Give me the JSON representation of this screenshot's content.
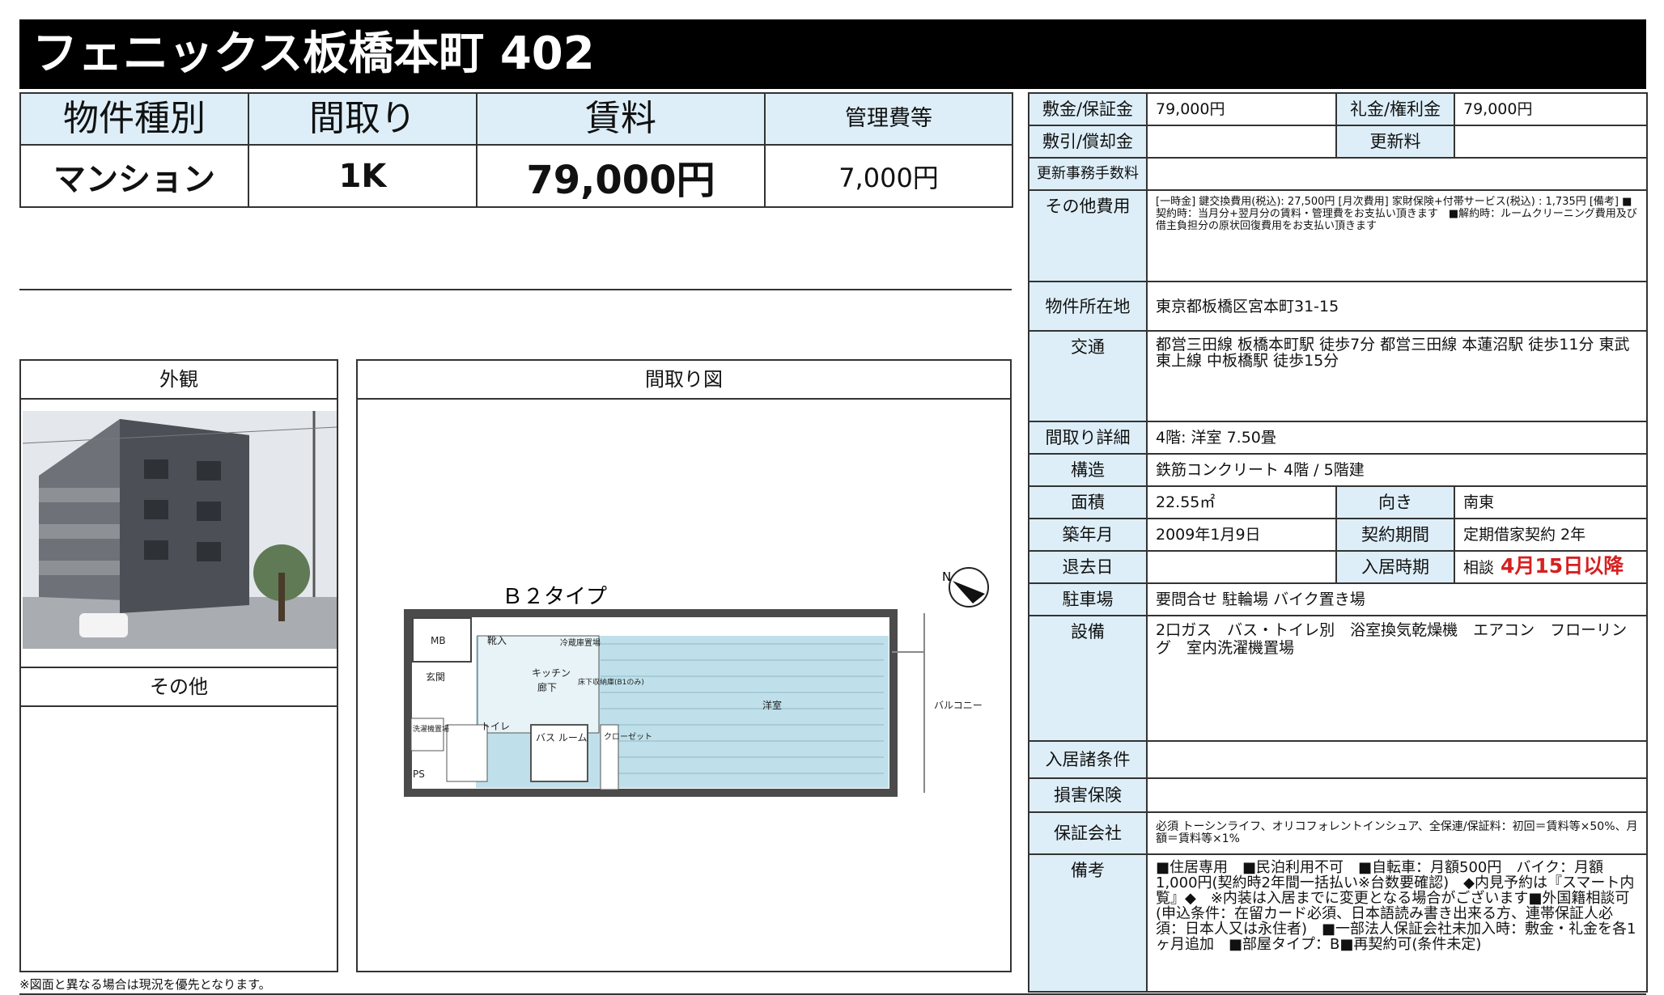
{
  "title": "フェニックス板橋本町 402",
  "summary": {
    "headers": [
      "物件種別",
      "間取り",
      "賃料",
      "管理費等"
    ],
    "values": [
      "マンション",
      "1K",
      "79,000円",
      "7,000円"
    ]
  },
  "panels": {
    "exterior": "外観",
    "other": "その他",
    "floorplan": "間取り図"
  },
  "floorplan": {
    "type_label": "Ｂ２タイプ",
    "compass": "N",
    "rooms": {
      "mb": "MB",
      "entrance_storage": "靴入",
      "fridge": "冷蔵庫置場",
      "kitchen": "キッチン",
      "hallway": "廊下",
      "underfloor": "床下収納庫(B1のみ)",
      "genkan": "玄関",
      "washer": "洗濯機置場",
      "toilet": "トイレ",
      "bath": "バス ルーム",
      "closet": "クローゼット",
      "western": "洋室",
      "balcony": "バルコニー",
      "ps": "PS"
    }
  },
  "note": "※図面と異なる場合は現況を優先となります。",
  "details": {
    "deposit_label": "敷金/保証金",
    "deposit": "79,000円",
    "key_money_label": "礼金/権利金",
    "key_money": "79,000円",
    "shikibiki_label": "敷引/償却金",
    "shikibiki": "",
    "renewal_label": "更新料",
    "renewal": "",
    "renewal_fee_label": "更新事務手数料",
    "renewal_fee": "",
    "other_costs_label": "その他費用",
    "other_costs": "[一時金] 鍵交換費用(税込): 27,500円\n[月次費用] 家財保険+付帯サービス(税込) : 1,735円\n[備考] ■契約時：当月分+翌月分の賃料・管理費をお支払い頂きます　■解約時：ルームクリーニング費用及び借主負担分の原状回復費用をお支払い頂きます",
    "address_label": "物件所在地",
    "address": "東京都板橋区宮本町31-15",
    "transport_label": "交通",
    "transport": "都営三田線 板橋本町駅 徒歩7分\n都営三田線 本蓮沼駅 徒歩11分\n東武東上線 中板橋駅 徒歩15分",
    "layout_detail_label": "間取り詳細",
    "layout_detail": "4階: 洋室 7.50畳",
    "structure_label": "構造",
    "structure": "鉄筋コンクリート 4階 / 5階建",
    "area_label": "面積",
    "area": "22.55㎡",
    "direction_label": "向き",
    "direction": "南東",
    "built_label": "築年月",
    "built": "2009年1月9日",
    "contract_label": "契約期間",
    "contract": "定期借家契約 2年",
    "vacate_label": "退去日",
    "vacate": "",
    "move_in_label": "入居時期",
    "move_in_prefix": "相談",
    "move_in_date": "4月15日以降",
    "parking_label": "駐車場",
    "parking": "要問合せ 駐輪場 バイク置き場",
    "equipment_label": "設備",
    "equipment": "2口ガス　バス・トイレ別　浴室換気乾燥機　エアコン　フローリング　室内洗濯機置場",
    "conditions_label": "入居諸条件",
    "conditions": "",
    "insurance_label": "損害保険",
    "insurance": "",
    "guarantor_label": "保証会社",
    "guarantor": "必須 トーシンライフ、オリコフォレントインシュア、全保連/保証料：初回＝賃料等×50%、月額＝賃料等×1%",
    "remarks_label": "備考",
    "remarks": "■住居専用　■民泊利用不可　■自転車：月額500円　バイク：月額1,000円(契約時2年間一括払い※台数要確認)　◆内見予約は『スマート内覧』◆　※内装は入居までに変更となる場合がございます■外国籍相談可(申込条件：在留カード必須、日本語読み書き出来る方、連帯保証人必須：日本人又は永住者)　■一部法人保証会社未加入時：敷金・礼金を各1ヶ月追加　■部屋タイプ：B■再契約可(条件未定)"
  },
  "colors": {
    "header_bg": "#000000",
    "label_bg": "#ddeef8",
    "accent_red": "#d62020",
    "floorplan_fill": "#bfe0ea"
  }
}
